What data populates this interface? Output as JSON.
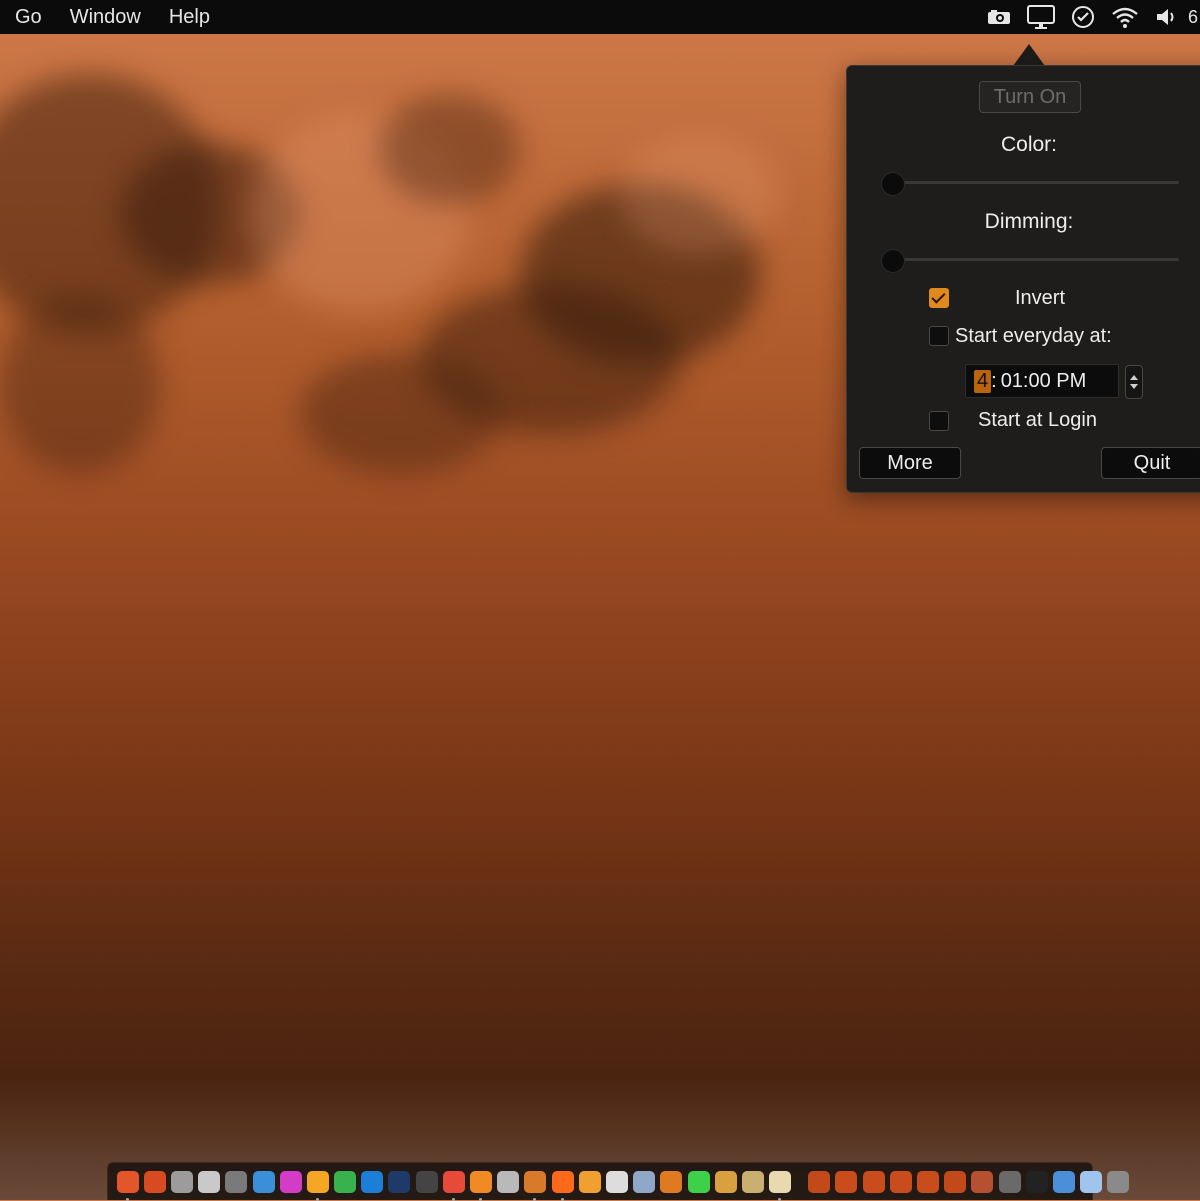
{
  "menubar": {
    "items": [
      "Go",
      "Window",
      "Help"
    ],
    "clock_fragment": "6"
  },
  "panel": {
    "turn_on_label": "Turn On",
    "color_label": "Color:",
    "color_level": 0,
    "dimming_label": "Dimming:",
    "dimming_level": 0,
    "invert_label": "Invert",
    "invert_checked": true,
    "start_everyday_label": "Start everyday at:",
    "start_everyday_checked": false,
    "time": {
      "hour": "4",
      "separator": ":",
      "rest": "01:00 PM"
    },
    "start_login_label": "Start at Login",
    "start_login_checked": false,
    "more_label": "More",
    "quit_label": "Quit"
  },
  "colors": {
    "accent_orange": "#e08a1e",
    "panel_bg": "#1e1d1c",
    "menubar_bg": "#0b0b0b"
  },
  "dock": {
    "icons": [
      {
        "name": "dock-app-1-icon",
        "color": "#e3552a",
        "run": true
      },
      {
        "name": "dock-app-2-icon",
        "color": "#d84a1f",
        "run": false
      },
      {
        "name": "dock-app-3-icon",
        "color": "#9c9c9c",
        "run": false
      },
      {
        "name": "dock-calendar-icon",
        "color": "#c9c9c9",
        "run": false
      },
      {
        "name": "dock-app-5-icon",
        "color": "#7a7a7a",
        "run": false
      },
      {
        "name": "dock-app-6-icon",
        "color": "#3a8fd8",
        "run": false
      },
      {
        "name": "dock-app-7-icon",
        "color": "#d43cc7",
        "run": false
      },
      {
        "name": "dock-app-8-icon",
        "color": "#f5a623",
        "run": true
      },
      {
        "name": "dock-music-icon",
        "color": "#37b24d",
        "run": false
      },
      {
        "name": "dock-app-10-icon",
        "color": "#1c7ed6",
        "run": false
      },
      {
        "name": "dock-app-11-icon",
        "color": "#1e3a6a",
        "run": false
      },
      {
        "name": "dock-app-12-icon",
        "color": "#444444",
        "run": false
      },
      {
        "name": "dock-chrome-icon",
        "color": "#e84a3a",
        "run": true
      },
      {
        "name": "dock-safari-icon",
        "color": "#f08a24",
        "run": true
      },
      {
        "name": "dock-app-15-icon",
        "color": "#b9b9b9",
        "run": false
      },
      {
        "name": "dock-app-16-icon",
        "color": "#d97a2b",
        "run": true
      },
      {
        "name": "dock-skype-icon",
        "color": "#ff6a1a",
        "run": true
      },
      {
        "name": "dock-app-18-icon",
        "color": "#f0a030",
        "run": false
      },
      {
        "name": "dock-app-19-icon",
        "color": "#dddddd",
        "run": false
      },
      {
        "name": "dock-app-20-icon",
        "color": "#8fa8c8",
        "run": false
      },
      {
        "name": "dock-dropbox-icon",
        "color": "#e07a20",
        "run": false
      },
      {
        "name": "dock-app-22-icon",
        "color": "#3fd04a",
        "run": false
      },
      {
        "name": "dock-app-23-icon",
        "color": "#d9a040",
        "run": false
      },
      {
        "name": "dock-app-24-icon",
        "color": "#c9b070",
        "run": false
      },
      {
        "name": "dock-photoshop-icon",
        "color": "#e8d9b0",
        "run": true
      }
    ],
    "icons_right": [
      {
        "name": "dock-minimized-1-icon",
        "color": "#c24a1a"
      },
      {
        "name": "dock-minimized-2-icon",
        "color": "#c94c1c"
      },
      {
        "name": "dock-minimized-3-icon",
        "color": "#c94c1c"
      },
      {
        "name": "dock-minimized-4-icon",
        "color": "#c94c1c"
      },
      {
        "name": "dock-minimized-5-icon",
        "color": "#c94c1c"
      },
      {
        "name": "dock-minimized-6-icon",
        "color": "#c24a1a"
      },
      {
        "name": "dock-minimized-7-icon",
        "color": "#b55030"
      },
      {
        "name": "dock-minimized-8-icon",
        "color": "#6a6a6a"
      },
      {
        "name": "dock-minimized-9-icon",
        "color": "#222222"
      },
      {
        "name": "dock-minimized-10-icon",
        "color": "#4a8fd8"
      },
      {
        "name": "dock-minimized-11-icon",
        "color": "#9fc5ef"
      },
      {
        "name": "dock-trash-icon",
        "color": "#8a8a8a"
      }
    ]
  }
}
